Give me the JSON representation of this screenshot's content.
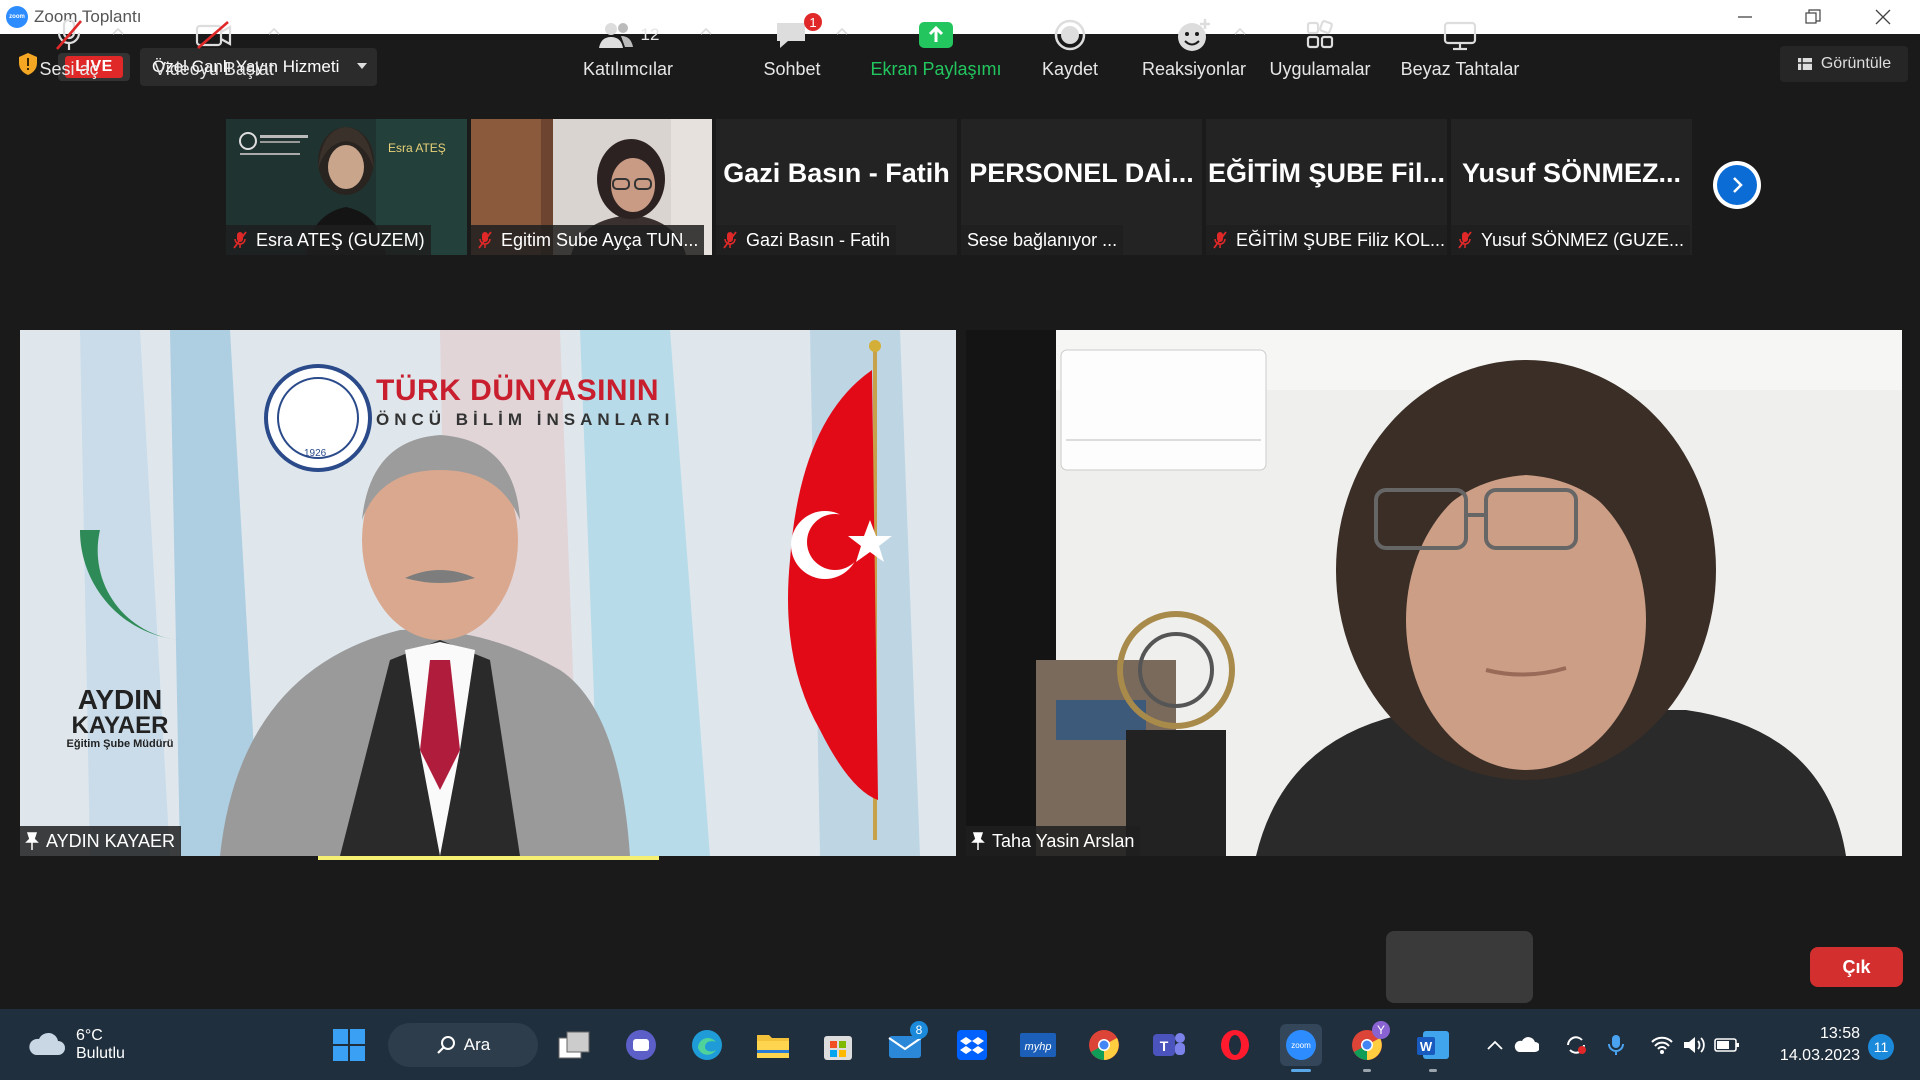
{
  "window": {
    "title": "Zoom Toplantı"
  },
  "topbar": {
    "live_label": "LIVE",
    "stream_label": "Özel Canlı Yayın Hizmeti",
    "view_label": "Görüntüle"
  },
  "strip": [
    {
      "big": "",
      "label": "Esra ATEŞ (GUZEM)",
      "muted": true,
      "video": true
    },
    {
      "big": "",
      "label": "Egitim Sube Ayça TUN...",
      "muted": true,
      "video": true
    },
    {
      "big": "Gazi Basın - Fatih",
      "label": "Gazi Basın - Fatih",
      "muted": true,
      "video": false
    },
    {
      "big": "PERSONEL DAİ...",
      "label": "Sese bağlanıyor ...",
      "muted": false,
      "video": false
    },
    {
      "big": "EĞİTİM ŞUBE Fil...",
      "label": "EĞİTİM ŞUBE Filiz KOL...",
      "muted": true,
      "video": false
    },
    {
      "big": "Yusuf SÖNMEZ...",
      "label": "Yusuf SÖNMEZ (GUZE...",
      "muted": true,
      "video": false
    }
  ],
  "strip_thumb_text": {
    "esra_caption": "Esra ATEŞ"
  },
  "main_videos": {
    "left": {
      "name": "AYDIN KAYAER",
      "banner_line1": "TÜRK DÜNYASININ",
      "banner_line2": "ÖNCÜ BİLİM İNSANLARI",
      "nameplate_1": "AYDIN",
      "nameplate_2": "KAYAER",
      "nameplate_3": "Eğitim Şube Müdürü",
      "seal_year": "1926"
    },
    "right": {
      "name": "Taha Yasin Arslan"
    }
  },
  "toolbar": {
    "unmute": "Sesi aç",
    "start_video": "Videoyu Başlat",
    "participants": "Katılımcılar",
    "participants_count": "12",
    "chat": "Sohbet",
    "chat_badge": "1",
    "share": "Ekran Paylaşımı",
    "record": "Kaydet",
    "reactions": "Reaksiyonlar",
    "apps": "Uygulamalar",
    "whiteboards": "Beyaz Tahtalar",
    "leave": "Çık"
  },
  "taskbar": {
    "weather_temp": "6°C",
    "weather_desc": "Bulutlu",
    "search_label": "Ara",
    "mail_badge": "8",
    "chrome_profile": "Y",
    "time": "13:58",
    "date": "14.03.2023",
    "notifications": "11"
  },
  "colors": {
    "live": "#e02828",
    "share_green": "#22c55e",
    "leave_red": "#d42f2f",
    "accent_blue": "#0b6cd6"
  }
}
